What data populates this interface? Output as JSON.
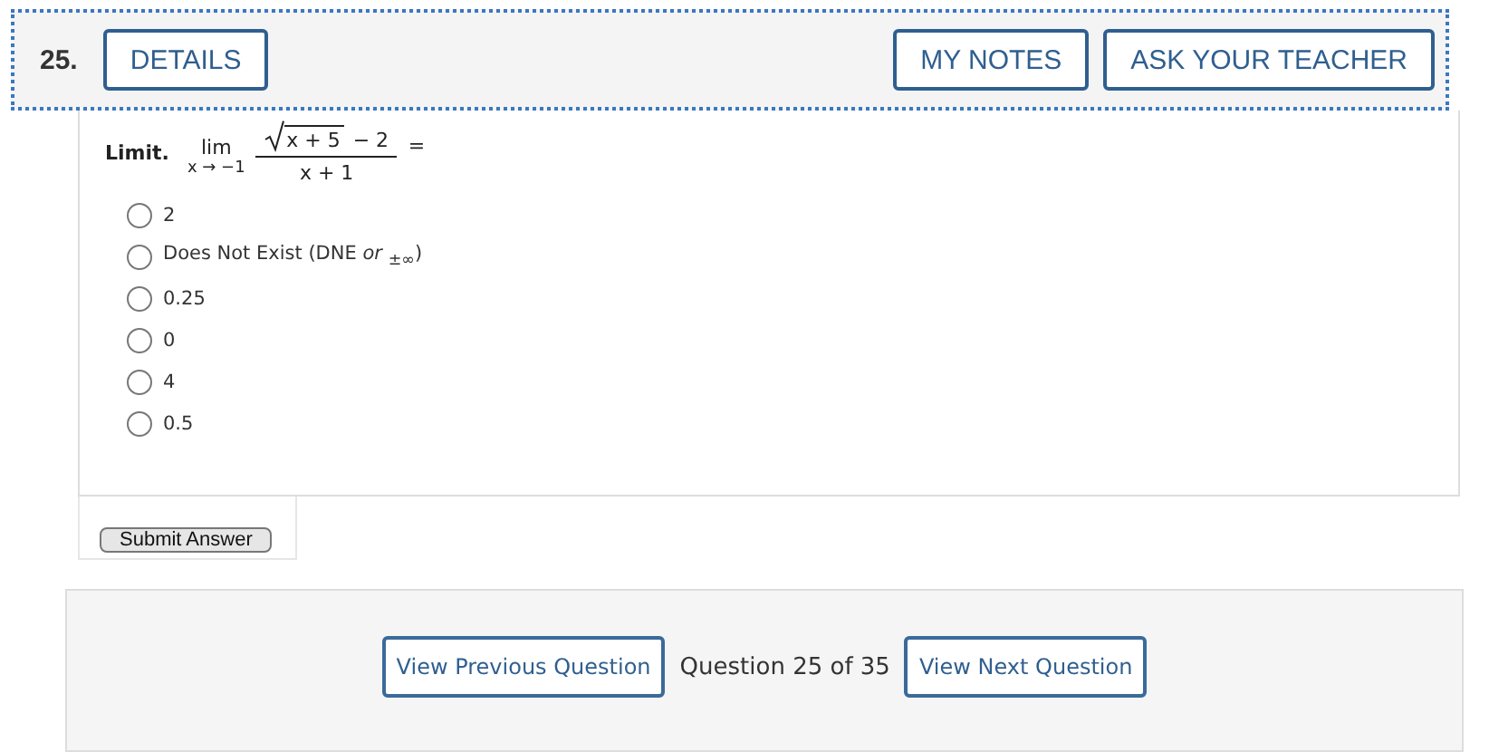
{
  "question": {
    "number": "25.",
    "details_button": "DETAILS",
    "notes_button": "MY NOTES",
    "teacher_button": "ASK YOUR TEACHER"
  },
  "problem": {
    "label": "Limit.",
    "lim": "lim",
    "lim_sub": "x → −1",
    "radicand": "x + 5",
    "numerator_rest": "− 2",
    "denominator": "x + 1",
    "equals": "="
  },
  "options": [
    {
      "label": "2",
      "selected": false
    },
    {
      "label": "Does Not Exist (DNE *or* $_{±∞}$)",
      "selected": false
    },
    {
      "label": "0.25",
      "selected": false
    },
    {
      "label": "0",
      "selected": false
    },
    {
      "label": "4",
      "selected": false
    },
    {
      "label": "0.5",
      "selected": false
    }
  ],
  "submit_button": "Submit Answer",
  "navigation": {
    "previous": "View Previous Question",
    "position": "Question 25 of 35",
    "next": "View Next Question"
  }
}
